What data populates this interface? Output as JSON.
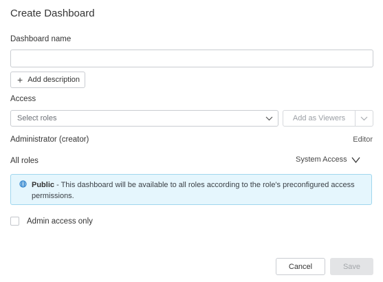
{
  "dialog": {
    "title": "Create Dashboard",
    "name_label": "Dashboard name",
    "name_value": "",
    "add_description_label": "Add description",
    "access_label": "Access",
    "roles_placeholder": "Select roles",
    "add_as_viewers_label": "Add as Viewers",
    "admin_role": "Administrator (creator)",
    "admin_permission": "Editor",
    "all_roles_label": "All roles",
    "system_access_label": "System Access",
    "info": {
      "icon": "globe-icon",
      "bold": "Public",
      "text": " - This dashboard will be available to all roles according to the role's preconfigured access permissions."
    },
    "admin_only_label": "Admin access only",
    "admin_only_checked": false,
    "cancel_label": "Cancel",
    "save_label": "Save"
  },
  "colors": {
    "info_background": "#e5f6fd",
    "info_border": "#9fd6ee",
    "globe": "#1f78c8",
    "save_disabled_bg": "#e3e4e6"
  }
}
